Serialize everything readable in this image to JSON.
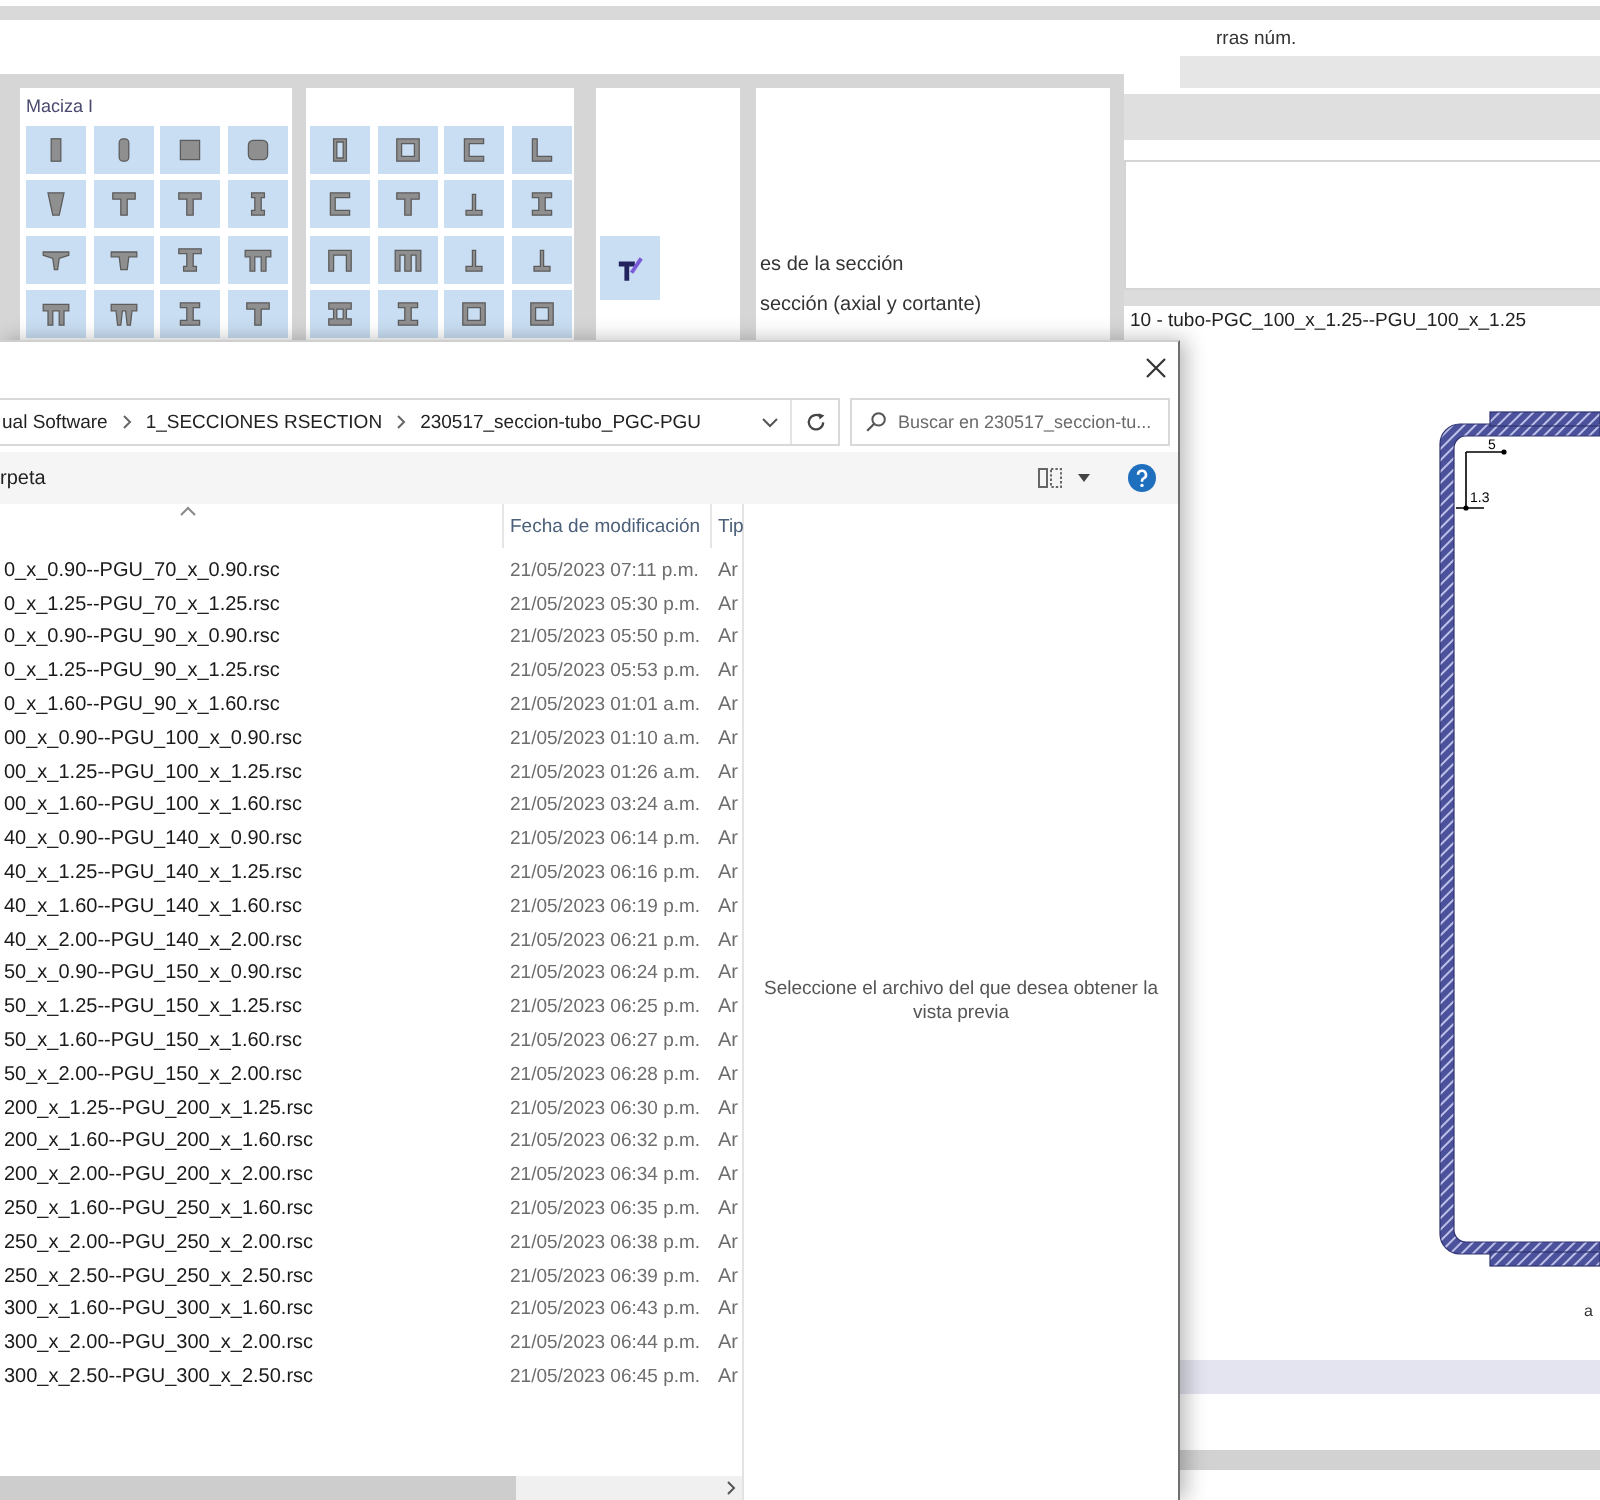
{
  "ribbon": {
    "status_text": "rras núm."
  },
  "palettes": [
    {
      "title": "Maciza I",
      "tiles": [
        {
          "kind": "bar"
        },
        {
          "kind": "rounded-bar"
        },
        {
          "kind": "square"
        },
        {
          "kind": "rounded-square"
        },
        {
          "kind": "trapezoid"
        },
        {
          "kind": "tee"
        },
        {
          "kind": "tee"
        },
        {
          "kind": "slim-i"
        },
        {
          "kind": "tapered-tee"
        },
        {
          "kind": "flared-tee"
        },
        {
          "kind": "bulb-tee"
        },
        {
          "kind": "pi"
        },
        {
          "kind": "pi"
        },
        {
          "kind": "tapered-pi"
        },
        {
          "kind": "i-beam"
        },
        {
          "kind": "tee"
        }
      ]
    },
    {
      "tiles": [
        {
          "kind": "hollow-rect"
        },
        {
          "kind": "hollow-square"
        },
        {
          "kind": "channel"
        },
        {
          "kind": "angle"
        },
        {
          "kind": "channel"
        },
        {
          "kind": "tee"
        },
        {
          "kind": "inverted-tee"
        },
        {
          "kind": "i-beam"
        },
        {
          "kind": "portal"
        },
        {
          "kind": "double-portal"
        },
        {
          "kind": "inverted-tee"
        },
        {
          "kind": "inverted-tee"
        },
        {
          "kind": "double-i"
        },
        {
          "kind": "i-beam"
        },
        {
          "kind": "hollow-square"
        },
        {
          "kind": "hollow-square"
        }
      ]
    },
    {
      "tiles": [
        {
          "kind": "custom"
        }
      ]
    }
  ],
  "section_panel": {
    "lines": [
      "es de la sección",
      "sección (axial y cortante)"
    ]
  },
  "canvas": {
    "title": "10 - tubo-PGC_100_x_1.25--PGU_100_x_1.25",
    "dimension_labels": [
      "5",
      "1.3"
    ],
    "edge_text": "a"
  },
  "file_dialog": {
    "address": {
      "path": [
        "ual Software",
        "1_SECCIONES RSECTION",
        "230517_seccion-tubo_PGC-PGU"
      ]
    },
    "search": {
      "placeholder": "Buscar en 230517_seccion-tu..."
    },
    "toolbar": {
      "button": "rpeta"
    },
    "columns": [
      {
        "sorted": true
      },
      {
        "label": "Fecha de modificación",
        "sorted": false
      },
      {
        "label": "Tip",
        "sorted": false
      }
    ],
    "files": [
      {
        "name": "0_x_0.90--PGU_70_x_0.90.rsc",
        "modified": "21/05/2023 07:11 p.m.",
        "type": "Ar"
      },
      {
        "name": "0_x_1.25--PGU_70_x_1.25.rsc",
        "modified": "21/05/2023 05:30 p.m.",
        "type": "Ar"
      },
      {
        "name": "0_x_0.90--PGU_90_x_0.90.rsc",
        "modified": "21/05/2023 05:50 p.m.",
        "type": "Ar"
      },
      {
        "name": "0_x_1.25--PGU_90_x_1.25.rsc",
        "modified": "21/05/2023 05:53 p.m.",
        "type": "Ar"
      },
      {
        "name": "0_x_1.60--PGU_90_x_1.60.rsc",
        "modified": "21/05/2023 01:01 a.m.",
        "type": "Ar"
      },
      {
        "name": "00_x_0.90--PGU_100_x_0.90.rsc",
        "modified": "21/05/2023 01:10 a.m.",
        "type": "Ar"
      },
      {
        "name": "00_x_1.25--PGU_100_x_1.25.rsc",
        "modified": "21/05/2023 01:26 a.m.",
        "type": "Ar"
      },
      {
        "name": "00_x_1.60--PGU_100_x_1.60.rsc",
        "modified": "21/05/2023 03:24 a.m.",
        "type": "Ar"
      },
      {
        "name": "40_x_0.90--PGU_140_x_0.90.rsc",
        "modified": "21/05/2023 06:14 p.m.",
        "type": "Ar"
      },
      {
        "name": "40_x_1.25--PGU_140_x_1.25.rsc",
        "modified": "21/05/2023 06:16 p.m.",
        "type": "Ar"
      },
      {
        "name": "40_x_1.60--PGU_140_x_1.60.rsc",
        "modified": "21/05/2023 06:19 p.m.",
        "type": "Ar"
      },
      {
        "name": "40_x_2.00--PGU_140_x_2.00.rsc",
        "modified": "21/05/2023 06:21 p.m.",
        "type": "Ar"
      },
      {
        "name": "50_x_0.90--PGU_150_x_0.90.rsc",
        "modified": "21/05/2023 06:24 p.m.",
        "type": "Ar"
      },
      {
        "name": "50_x_1.25--PGU_150_x_1.25.rsc",
        "modified": "21/05/2023 06:25 p.m.",
        "type": "Ar"
      },
      {
        "name": "50_x_1.60--PGU_150_x_1.60.rsc",
        "modified": "21/05/2023 06:27 p.m.",
        "type": "Ar"
      },
      {
        "name": "50_x_2.00--PGU_150_x_2.00.rsc",
        "modified": "21/05/2023 06:28 p.m.",
        "type": "Ar"
      },
      {
        "name": "200_x_1.25--PGU_200_x_1.25.rsc",
        "modified": "21/05/2023 06:30 p.m.",
        "type": "Ar"
      },
      {
        "name": "200_x_1.60--PGU_200_x_1.60.rsc",
        "modified": "21/05/2023 06:32 p.m.",
        "type": "Ar"
      },
      {
        "name": "200_x_2.00--PGU_200_x_2.00.rsc",
        "modified": "21/05/2023 06:34 p.m.",
        "type": "Ar"
      },
      {
        "name": "250_x_1.60--PGU_250_x_1.60.rsc",
        "modified": "21/05/2023 06:35 p.m.",
        "type": "Ar"
      },
      {
        "name": "250_x_2.00--PGU_250_x_2.00.rsc",
        "modified": "21/05/2023 06:38 p.m.",
        "type": "Ar"
      },
      {
        "name": "250_x_2.50--PGU_250_x_2.50.rsc",
        "modified": "21/05/2023 06:39 p.m.",
        "type": "Ar"
      },
      {
        "name": "300_x_1.60--PGU_300_x_1.60.rsc",
        "modified": "21/05/2023 06:43 p.m.",
        "type": "Ar"
      },
      {
        "name": "300_x_2.00--PGU_300_x_2.00.rsc",
        "modified": "21/05/2023 06:44 p.m.",
        "type": "Ar"
      },
      {
        "name": "300_x_2.50--PGU_300_x_2.50.rsc",
        "modified": "21/05/2023 06:45 p.m.",
        "type": "Ar"
      }
    ],
    "preview_message": "Seleccione el archivo del que desea obtener la vista previa"
  }
}
